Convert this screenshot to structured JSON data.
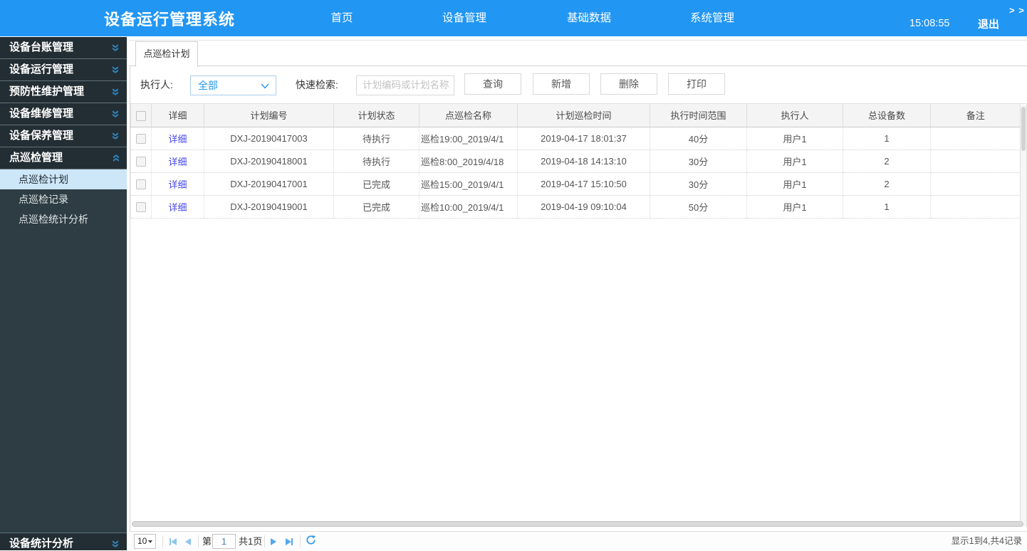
{
  "header": {
    "title": "设备运行管理系统",
    "nav": [
      "首页",
      "设备管理",
      "基础数据",
      "系统管理"
    ],
    "time": "15:08:55",
    "logout": "退出",
    "collapse": "> >"
  },
  "sidebar": {
    "items": [
      "设备台账管理",
      "设备运行管理",
      "预防性维护管理",
      "设备维修管理",
      "设备保养管理",
      "点巡检管理"
    ],
    "sub_items": [
      "点巡检计划",
      "点巡检记录",
      "点巡检统计分析"
    ],
    "selected_sub": "点巡检计划",
    "bottom_item": "设备统计分析"
  },
  "tab": "点巡检计划",
  "filter": {
    "executor_label": "执行人:",
    "executor_value": "全部",
    "search_label": "快速检索:",
    "search_placeholder": "计划编码或计划名称",
    "buttons": [
      "查询",
      "新增",
      "删除",
      "打印"
    ]
  },
  "table": {
    "columns": [
      "详细",
      "计划编号",
      "计划状态",
      "点巡检名称",
      "计划巡检时间",
      "执行时间范围",
      "执行人",
      "总设备数",
      "备注"
    ],
    "rows": [
      {
        "detail": "详细",
        "code": "DXJ-20190417003",
        "status": "待执行",
        "name": "巡检19:00_2019/4/1",
        "time": "2019-04-17 18:01:37",
        "range": "40分",
        "executor": "用户1",
        "count": "1",
        "remark": ""
      },
      {
        "detail": "详细",
        "code": "DXJ-20190418001",
        "status": "待执行",
        "name": "巡检8:00_2019/4/18",
        "time": "2019-04-18 14:13:10",
        "range": "30分",
        "executor": "用户1",
        "count": "2",
        "remark": ""
      },
      {
        "detail": "详细",
        "code": "DXJ-20190417001",
        "status": "已完成",
        "name": "巡检15:00_2019/4/1",
        "time": "2019-04-17 15:10:50",
        "range": "30分",
        "executor": "用户1",
        "count": "2",
        "remark": ""
      },
      {
        "detail": "详细",
        "code": "DXJ-20190419001",
        "status": "已完成",
        "name": "巡检10:00_2019/4/1",
        "time": "2019-04-19 09:10:04",
        "range": "50分",
        "executor": "用户1",
        "count": "1",
        "remark": ""
      }
    ]
  },
  "pager": {
    "page_size": "10",
    "page_label": "第",
    "page_value": "1",
    "total_label": "共1页",
    "info": "显示1到4,共4记录"
  },
  "colors": {
    "header_blue": "#2196f3",
    "sidebar_dark": "#232e34",
    "sidebar_panel": "#2e3d44",
    "selected_item_bg": "#cde6f8",
    "link_blue": "#4646e8"
  }
}
